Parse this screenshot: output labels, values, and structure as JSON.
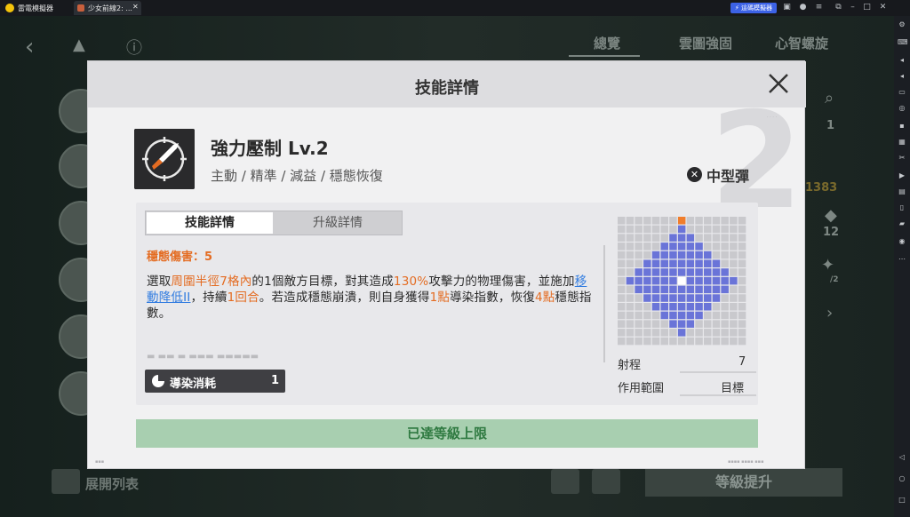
{
  "titlebar": {
    "app_name": "雷電模擬器",
    "tab_title": "少女前線2: ...",
    "tab_close": "✕",
    "multi_badge": "⚡ 這碼模擬器"
  },
  "game": {
    "tabs": [
      "總覽",
      "雲圖強固",
      "心智螺旋"
    ],
    "side_counts": [
      "1",
      "12"
    ],
    "gold_value": "1383",
    "ratio_label": "/2",
    "expand_list": "展開列表",
    "upgrade_button": "等級提升"
  },
  "modal": {
    "title": "技能詳情",
    "level_big": "2",
    "skill": {
      "name": "強力壓制 Lv.2",
      "tags": "主動 / 精準 / 減益 / 穩態恢復",
      "ammo_type": "中型彈"
    },
    "tabs": {
      "active": "技能詳情",
      "inactive": "升級詳情"
    },
    "stagger_damage": "穩態傷害：5",
    "description": [
      {
        "t": "選取",
        "c": "n"
      },
      {
        "t": "周圍半徑7格內",
        "c": "h"
      },
      {
        "t": "的1個敵方目標，對其造成",
        "c": "n"
      },
      {
        "t": "130%",
        "c": "h"
      },
      {
        "t": "攻擊力的物理傷害，並施加",
        "c": "n"
      },
      {
        "t": "移動降低II",
        "c": "l"
      },
      {
        "t": "，持續",
        "c": "n"
      },
      {
        "t": "1回合",
        "c": "h"
      },
      {
        "t": "。若造成穩態崩潰，則自身獲得",
        "c": "n"
      },
      {
        "t": "1點",
        "c": "h"
      },
      {
        "t": "導染指數，恢復",
        "c": "n"
      },
      {
        "t": "4點",
        "c": "h"
      },
      {
        "t": "穩態指數。",
        "c": "n"
      }
    ],
    "cost": {
      "label": "導染消耗",
      "value": "1"
    },
    "range": {
      "label": "射程",
      "value": "7"
    },
    "area": {
      "label": "作用範圍",
      "value": "目標"
    },
    "max_level": "已達等級上限"
  },
  "colors": {
    "highlight": "#e46c22",
    "link": "#2f7be0",
    "grid_empty": "#c9c9cd",
    "grid_range": "#6a74d8",
    "grid_origin": "#ffffff",
    "grid_target": "#f07d2b",
    "max_bar": "#a8cfb0"
  },
  "icons": {
    "skill": "rocket-target-icon",
    "close": "close-icon",
    "ammo": "ammo-icon",
    "cost": "pie-timer-icon",
    "prev": "chevron-left-icon",
    "next": "chevron-right-icon"
  }
}
